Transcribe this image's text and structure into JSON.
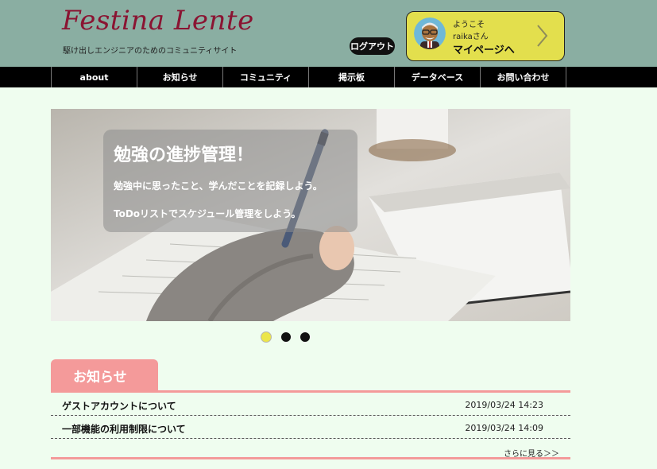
{
  "header": {
    "logo": "Festina Lente",
    "tagline": "駆け出しエンジニアのためのコミュニティサイト",
    "logout_label": "ログアウト",
    "user_card": {
      "welcome": "ようこそ",
      "username": "raikaさん",
      "mypage_label": "マイページへ",
      "avatar_icon": "user-avatar-icon",
      "chevron_icon": "chevron-right-icon"
    }
  },
  "nav": {
    "items": [
      {
        "label": "about"
      },
      {
        "label": "お知らせ"
      },
      {
        "label": "コミュニティ"
      },
      {
        "label": "掲示板"
      },
      {
        "label": "データベース"
      },
      {
        "label": "お問い合わせ"
      }
    ]
  },
  "hero": {
    "title": "勉強の進捗管理！",
    "line1": "勉強中に思ったこと、学んだことを記録しよう。",
    "line2": "ToDoリストでスケジュール管理をしよう。",
    "slide_count": 3,
    "active_slide": 1
  },
  "news": {
    "heading": "お知らせ",
    "items": [
      {
        "title": "ゲストアカウントについて",
        "date": "2019/03/24 14:23"
      },
      {
        "title": "一部機能の利用制限について",
        "date": "2019/03/24 14:09"
      }
    ],
    "more_label": "さらに見る＞＞"
  },
  "colors": {
    "header_bg": "#8aaea2",
    "logo": "#8a1432",
    "card_bg": "#e3df4d",
    "page_bg": "#effdef",
    "accent_pink": "#f49a9a",
    "nav_bg": "#000000"
  }
}
